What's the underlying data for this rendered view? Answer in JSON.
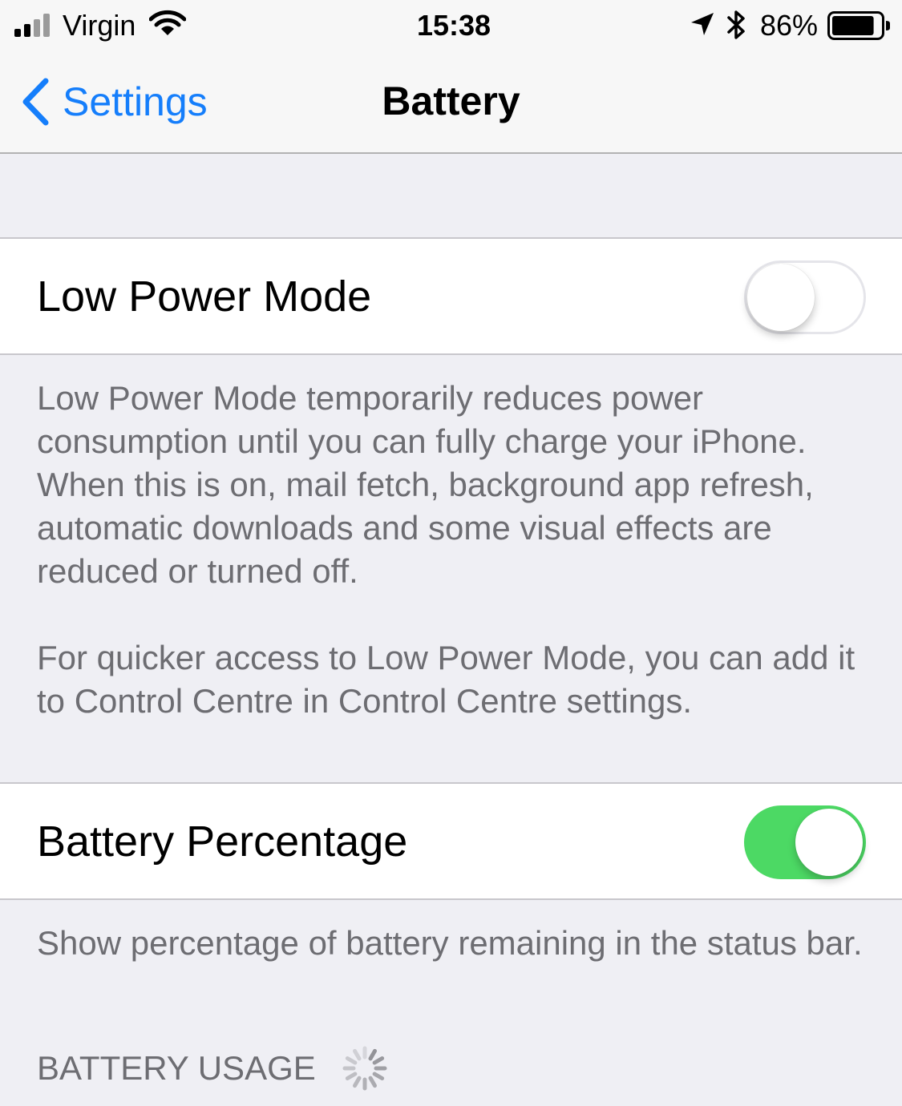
{
  "status_bar": {
    "carrier": "Virgin",
    "time": "15:38",
    "battery_percent": "86%",
    "battery_level": 0.86,
    "signal_bars_filled": 2,
    "signal_bars_total": 4,
    "icons": [
      "signal-icon",
      "wifi-icon",
      "location-arrow-icon",
      "bluetooth-icon",
      "battery-icon"
    ]
  },
  "nav": {
    "back_label": "Settings",
    "title": "Battery",
    "back_icon": "chevron-left-icon"
  },
  "low_power": {
    "label": "Low Power Mode",
    "enabled": false,
    "footer_1": "Low Power Mode temporarily reduces power consumption until you can fully charge your iPhone. When this is on, mail fetch, background app refresh, automatic downloads and some visual effects are reduced or turned off.",
    "footer_2": "For quicker access to Low Power Mode, you can add it to Control Centre in Control Centre settings."
  },
  "battery_percentage": {
    "label": "Battery Percentage",
    "enabled": true,
    "footer": "Show percentage of battery remaining in the status bar."
  },
  "battery_usage": {
    "header": "BATTERY USAGE",
    "loading_icon": "spinner-icon"
  },
  "colors": {
    "accent": "#157efb",
    "toggle_on": "#4cd964",
    "background": "#efeff4",
    "footer_text": "#6d6d72"
  }
}
